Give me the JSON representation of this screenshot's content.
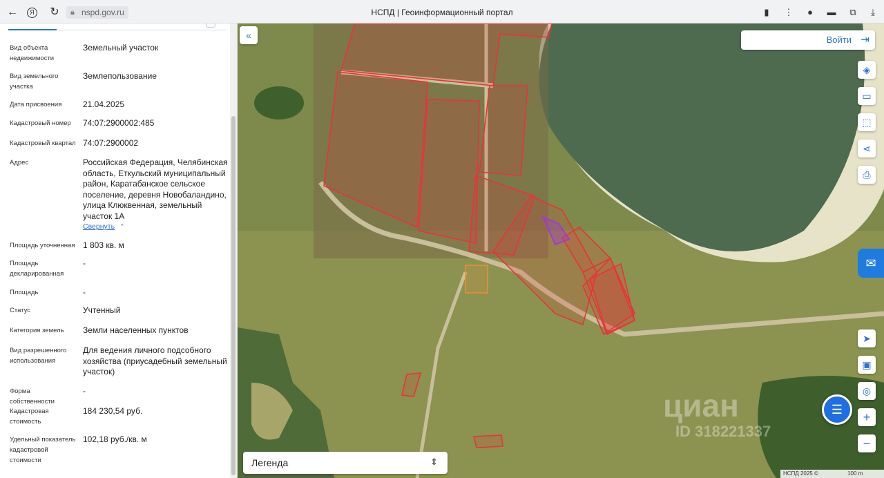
{
  "browser": {
    "url": "nspd.gov.ru",
    "title": "НСПД | Геоинформационный портал",
    "icons": [
      "back-arrow-icon",
      "yandex-icon",
      "reload-icon",
      "lock-icon",
      "bookmark-icon",
      "more-icon",
      "extension-icon",
      "download-icon"
    ]
  },
  "panel": {
    "rows": [
      {
        "label": "Вид объекта недвижимости",
        "value": "Земельный участок"
      },
      {
        "label": "Вид земельного участка",
        "value": "Землепользование"
      },
      {
        "label": "Дата присвоения",
        "value": "21.04.2025"
      },
      {
        "label": "Кадастровый номер",
        "value": "74:07:2900002:485"
      },
      {
        "label": "Кадастровый квартал",
        "value": "74:07:2900002"
      },
      {
        "label": "Адрес",
        "value": "Российская Федерация, Челябинская область, Еткульский муниципальный район, Каратабанское сельское поселение, деревня Новобаландино, улица Клюквенная, земельный участок 1А"
      },
      {
        "label": "Площадь уточненная",
        "value": "1 803 кв. м"
      },
      {
        "label": "Площадь декларированная",
        "value": "-"
      },
      {
        "label": "Площадь",
        "value": "-"
      },
      {
        "label": "Статус",
        "value": "Учтенный"
      },
      {
        "label": "Категория земель",
        "value": "Земли населенных пунктов"
      },
      {
        "label": "Вид разрешенного использования",
        "value": "Для ведения личного подсобного хозяйства (приусадебный земельный участок)"
      },
      {
        "label": "Форма собственности",
        "value": "-"
      },
      {
        "label": "Кадастровая стоимость",
        "value": "184 230,54 руб."
      },
      {
        "label": "Удельный показатель кадастровой стоимости",
        "value": "102,18 руб./кв. м"
      }
    ],
    "collapse_link": "Свернуть"
  },
  "map": {
    "login_label": "Войти",
    "legend_label": "Легенда",
    "watermark": "циан",
    "watermark_id": "ID 318221337",
    "scale_text": "НСПД 2025 ©",
    "scale_len": "100 m",
    "colors": {
      "accent": "#2b6fd6",
      "parcel": "#e8343a",
      "selected": "#a03ad6",
      "lake": "#4e6b50"
    }
  }
}
